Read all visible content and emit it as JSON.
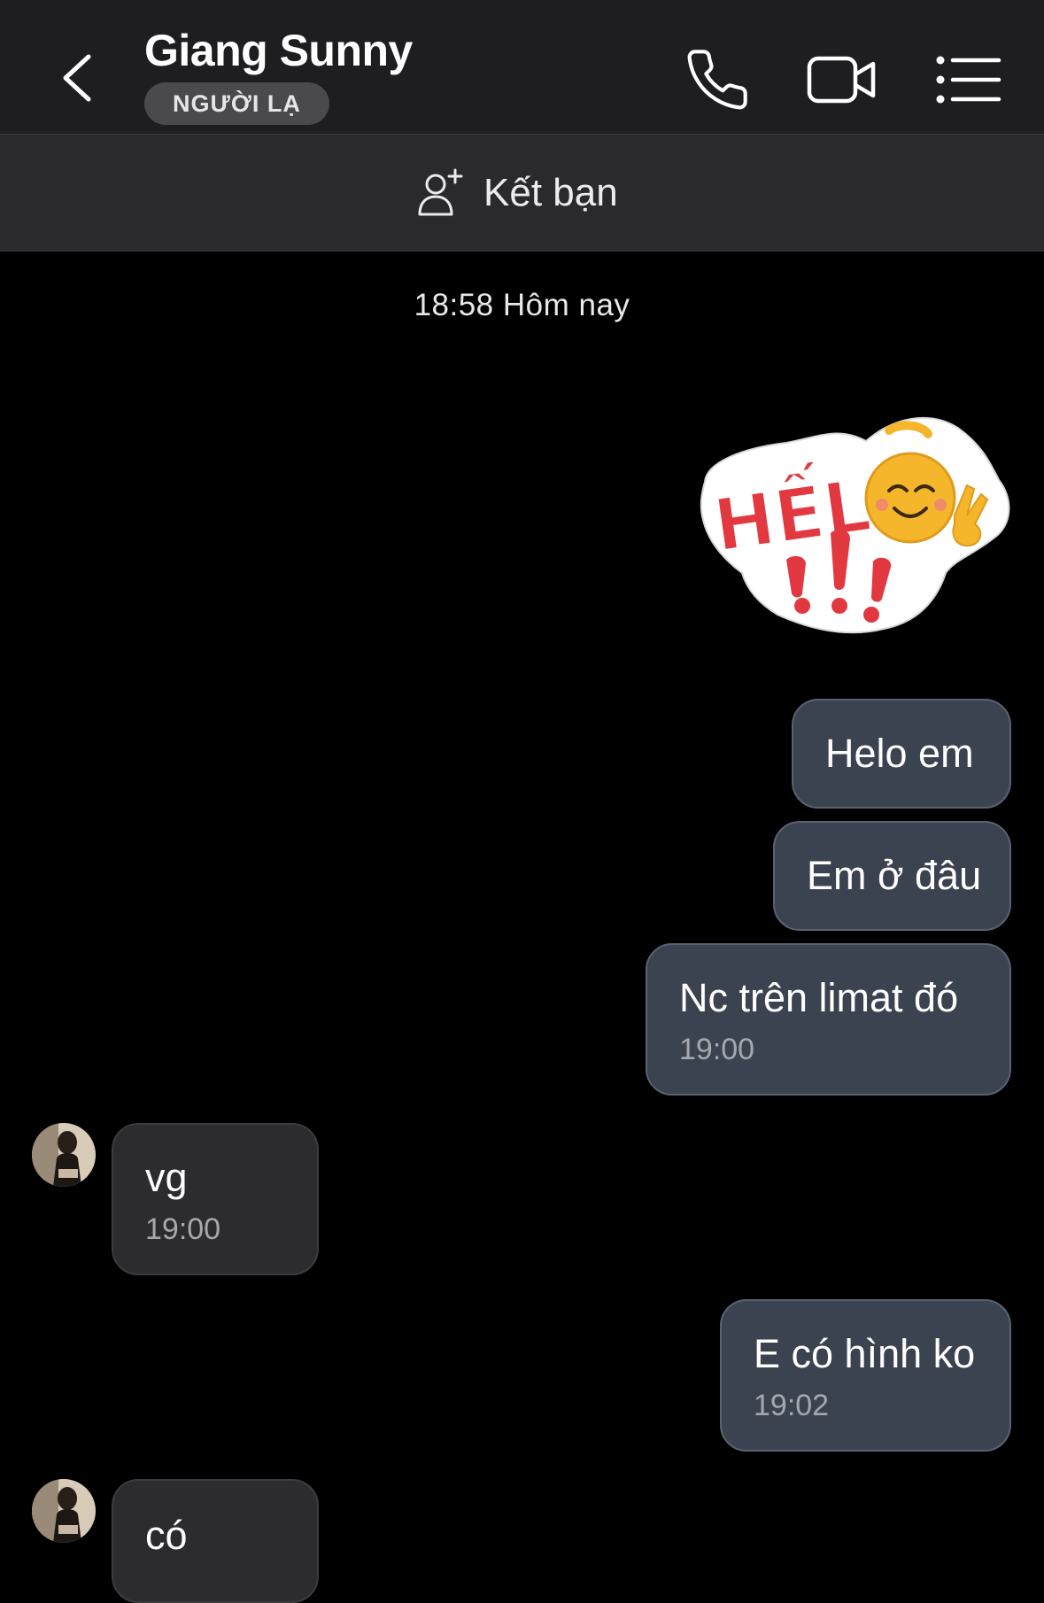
{
  "header": {
    "contact_name": "Giang Sunny",
    "badge": "NGƯỜI LẠ"
  },
  "friend_bar": {
    "label": "Kết bạn"
  },
  "conversation": {
    "date_divider": "18:58 Hôm nay",
    "sticker_text": "HẾLO!!!",
    "messages": [
      {
        "from": "me",
        "text": "Helo em"
      },
      {
        "from": "me",
        "text": "Em ở đâu"
      },
      {
        "from": "me",
        "text": "Nc trên limat đó",
        "time": "19:00"
      },
      {
        "from": "contact",
        "text": "vg",
        "time": "19:00"
      },
      {
        "from": "me",
        "text": "E có hình ko",
        "time": "19:02"
      },
      {
        "from": "contact",
        "text": "có"
      }
    ]
  },
  "colors": {
    "background": "#000000",
    "header": "#1e1e20",
    "outgoing_bubble": "#3b4250",
    "incoming_bubble": "#2c2c2e",
    "sticker_red": "#e2383f",
    "sticker_yellow": "#f6b62b"
  },
  "icons": [
    "chevron-left-icon",
    "phone-icon",
    "video-camera-icon",
    "list-menu-icon",
    "add-person-icon"
  ]
}
